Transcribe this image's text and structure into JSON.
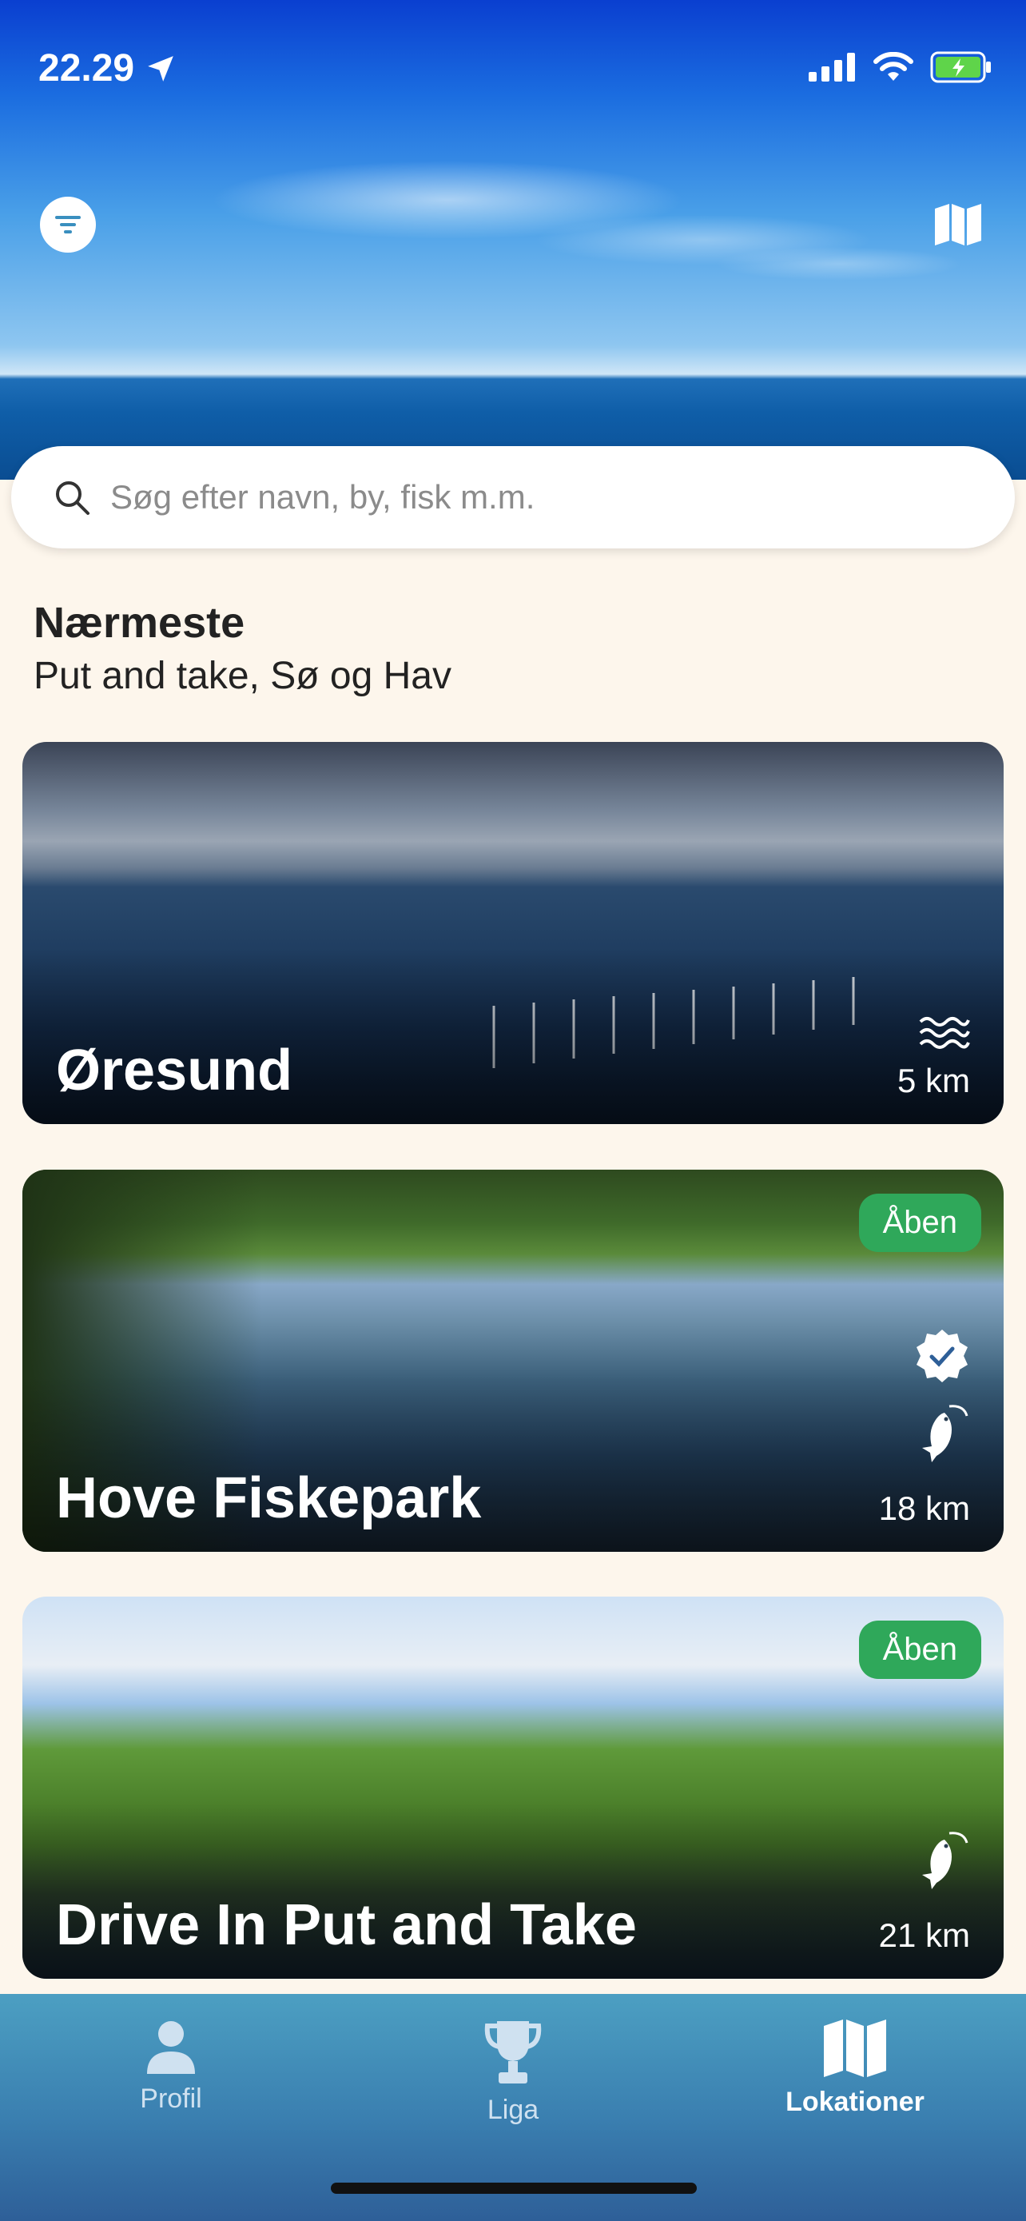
{
  "status": {
    "time": "22.29"
  },
  "search": {
    "placeholder": "Søg efter navn, by, fisk m.m."
  },
  "section": {
    "title": "Nærmeste",
    "subtitle": "Put and take, Sø og Hav"
  },
  "cards": [
    {
      "title": "Øresund",
      "distance": "5 km",
      "badge": null,
      "icons": [
        "waves-icon"
      ]
    },
    {
      "title": "Hove Fiskepark",
      "distance": "18 km",
      "badge": "Åben",
      "icons": [
        "verified-badge-icon",
        "fish-icon"
      ]
    },
    {
      "title": "Drive In Put and Take",
      "distance": "21 km",
      "badge": "Åben",
      "icons": [
        "fish-icon"
      ]
    }
  ],
  "nav": [
    {
      "label": "Profil",
      "icon": "person-icon",
      "active": false
    },
    {
      "label": "Liga",
      "icon": "trophy-icon",
      "active": false
    },
    {
      "label": "Lokationer",
      "icon": "map-icon",
      "active": true
    }
  ],
  "colors": {
    "background": "#fdf6ec",
    "badge": "#2fa85a",
    "battery": "#5fd44a"
  }
}
